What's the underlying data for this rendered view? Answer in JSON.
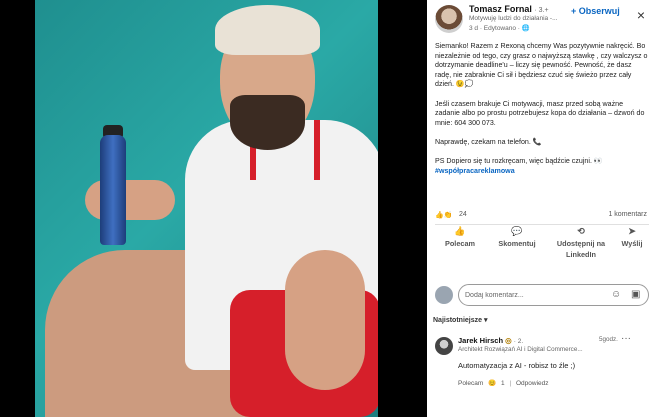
{
  "post": {
    "author": "Tomasz Fornal",
    "author_degree": "· 3.+",
    "subtitle": "Motywuję ludzi do działania -...",
    "meta": "3 d · Edytowano · ",
    "follow_label": "+ Obserwuj",
    "paragraphs": [
      "Siemanko! Razem z Rexoną chcemy Was pozytywnie nakręcić. Bo niezależnie od tego, czy grasz o najwyższą stawkę , czy walczysz o dotrzymanie deadline'u – liczy się pewność. Pewność, że dasz radę, nie zabraknie Ci sił i będziesz czuć się świeżo przez cały dzień. 😉💭",
      "Jeśli czasem brakuje Ci motywacji, masz przed sobą ważne zadanie albo po prostu potrzebujesz kopa do działania – dzwoń do mnie: 604 300 073.",
      "Naprawdę, czekam na telefon. 📞",
      "PS Dopiero się tu rozkręcam, więc bądźcie czujni. 👀"
    ],
    "hashtag": "#współpracareklamowa",
    "reactions_count": "24",
    "comments_count": "1 komentarz"
  },
  "actions": {
    "like": "Polecam",
    "comment": "Skomentuj",
    "share": "Udostępnij na LinkedIn",
    "send": "Wyślij"
  },
  "comment_input": {
    "placeholder": "Dodaj komentarz..."
  },
  "sort_label": "Najistotniejsze ▾",
  "comment": {
    "author": "Jarek Hirsch",
    "author_degree": "· 2.",
    "title": "Architekt Rozwiązań AI i Digital Commerce...",
    "time": "5godz.",
    "text": "Automatyzacja z AI - robisz to źle ;)",
    "like_label": "Polecam",
    "like_count": "1",
    "reply_label": "Odpowiedz"
  },
  "icons": {
    "close": "×",
    "emoji": "☺",
    "image": "▣",
    "more": "···"
  }
}
